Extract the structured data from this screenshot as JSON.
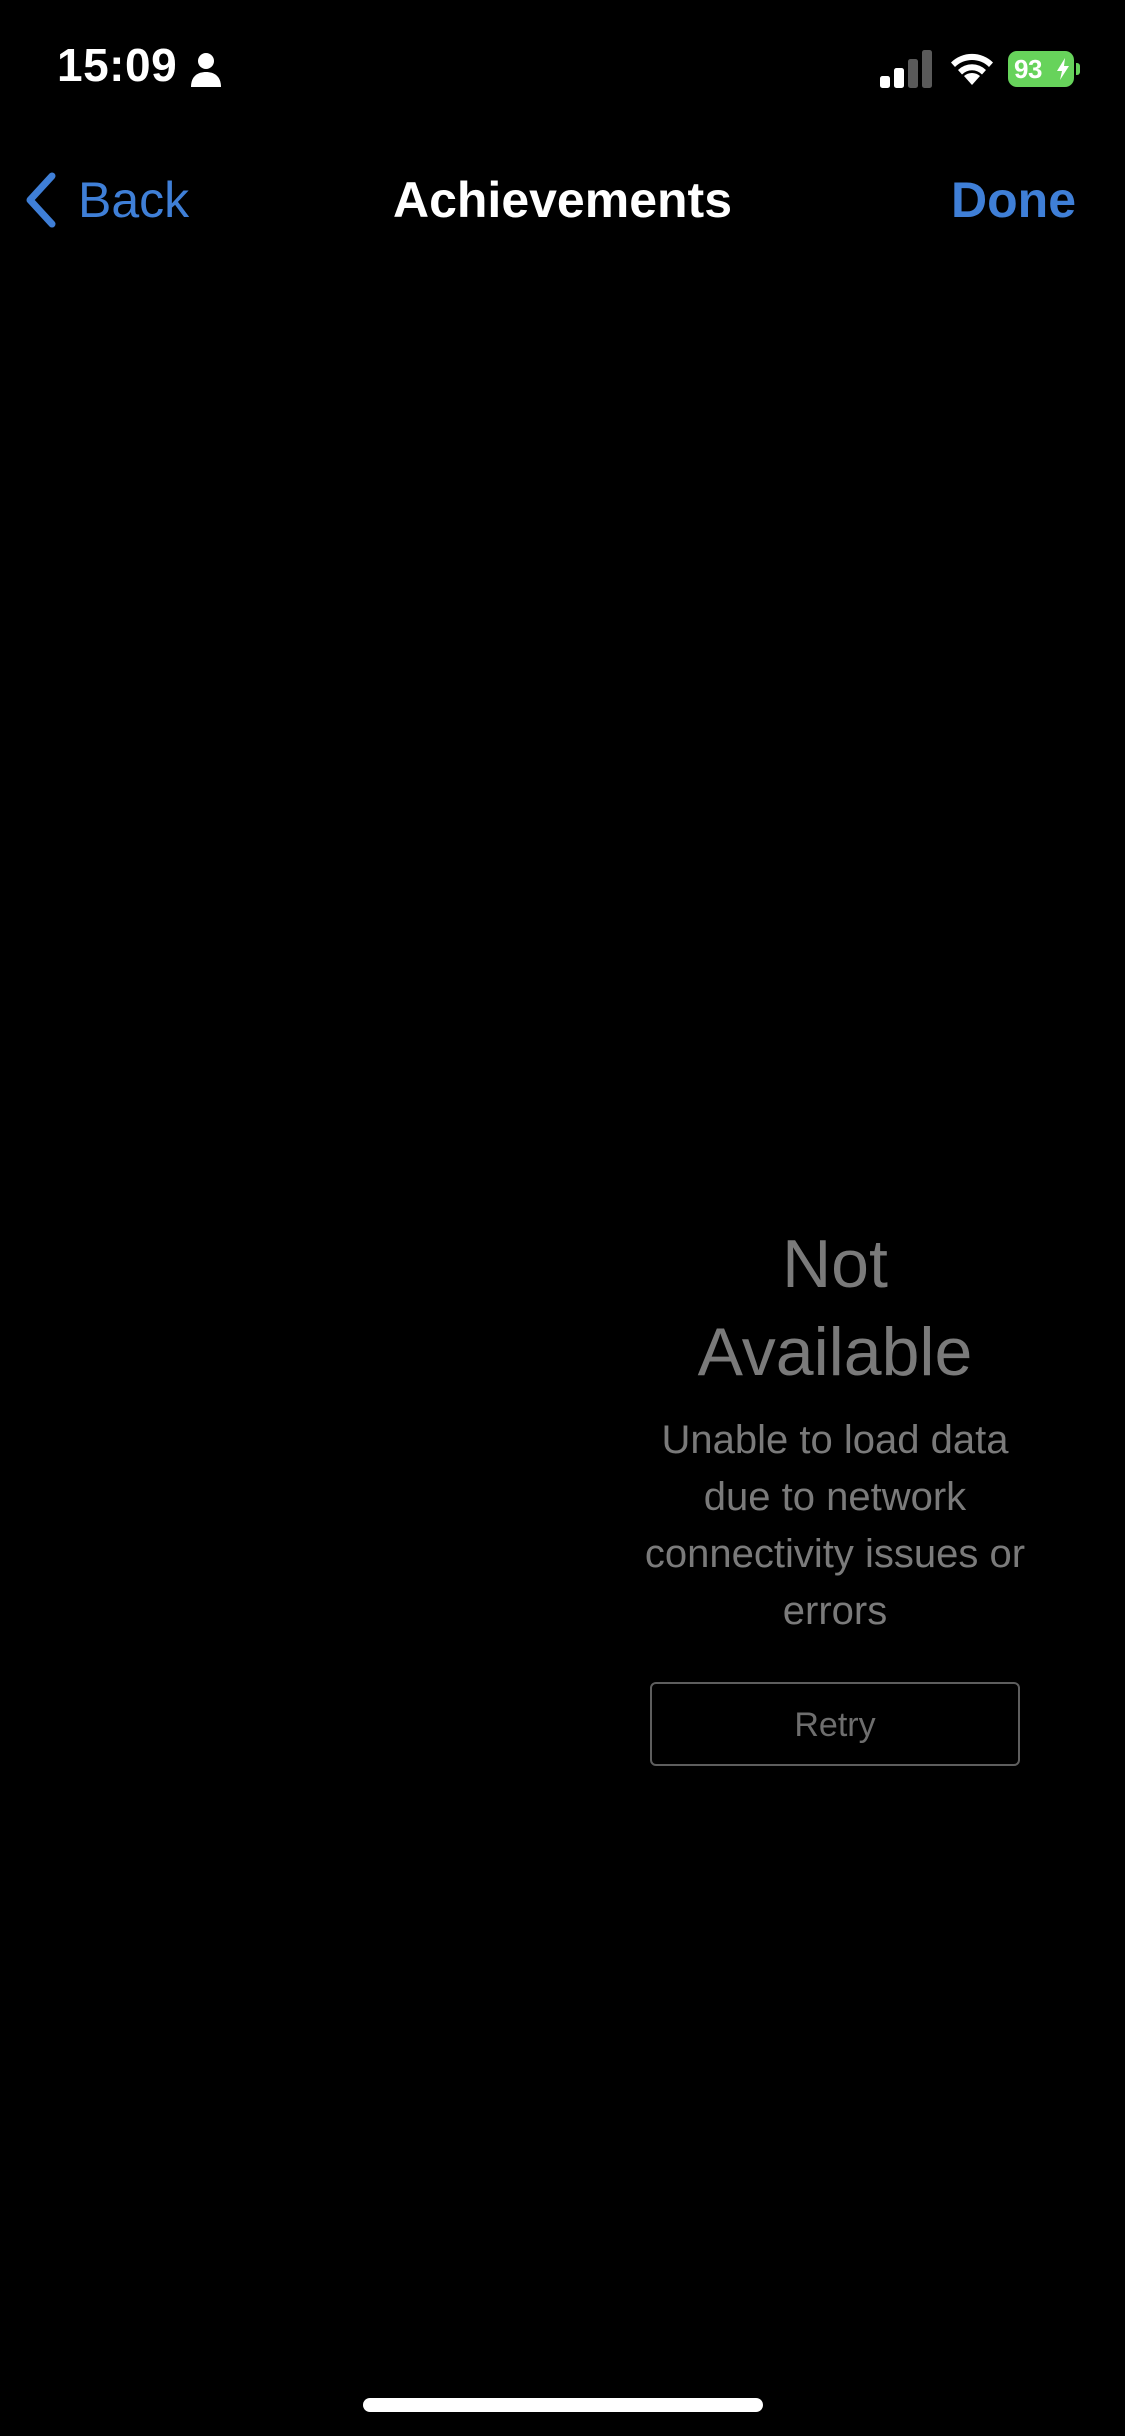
{
  "status_bar": {
    "time": "15:09",
    "battery_percent": "93",
    "battery_color": "#67d35b",
    "icons": [
      "person-icon",
      "signal-icon",
      "wifi-icon",
      "battery-icon",
      "bolt-icon"
    ]
  },
  "nav": {
    "back_label": "Back",
    "title": "Achievements",
    "done_label": "Done",
    "accent_color": "#3f7fd7"
  },
  "empty_state": {
    "title": "Not Available",
    "message": "Unable to load data due to network connectivity issues or errors",
    "retry_label": "Retry"
  }
}
